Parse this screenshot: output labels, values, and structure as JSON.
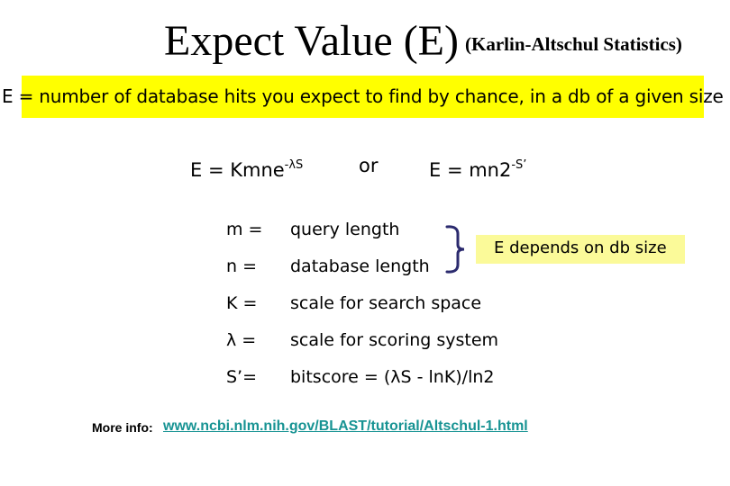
{
  "slide": {
    "title": "Expect Value (E)",
    "subtitle": "(Karlin-Altschul Statistics)",
    "definition": "E = number of database hits you expect to find by chance, in a db of a given size",
    "formulas": {
      "f1_base": "E = Kmne",
      "f1_exponent": "-λS",
      "connector": "or",
      "f2_base": "E = mn2",
      "f2_exponent": "-S’"
    },
    "variables": [
      {
        "symbol": "m =",
        "description": "query length"
      },
      {
        "symbol": "n =",
        "description": "database length"
      },
      {
        "symbol": "K =",
        "description": "scale for search space"
      },
      {
        "symbol": "λ =",
        "description": "scale for scoring system"
      },
      {
        "symbol": "S’=",
        "description": "bitscore = (λS - lnK)/ln2"
      }
    ],
    "callout": "E depends on db size",
    "more_info": {
      "label": "More info:",
      "link_text": "www.ncbi.nlm.nih.gov/BLAST/tutorial/Altschul-1.html"
    }
  },
  "colors": {
    "highlight": "#ffff00",
    "callout_bg": "#fbfa99",
    "brace": "#2b2a6e",
    "link": "#179393"
  }
}
